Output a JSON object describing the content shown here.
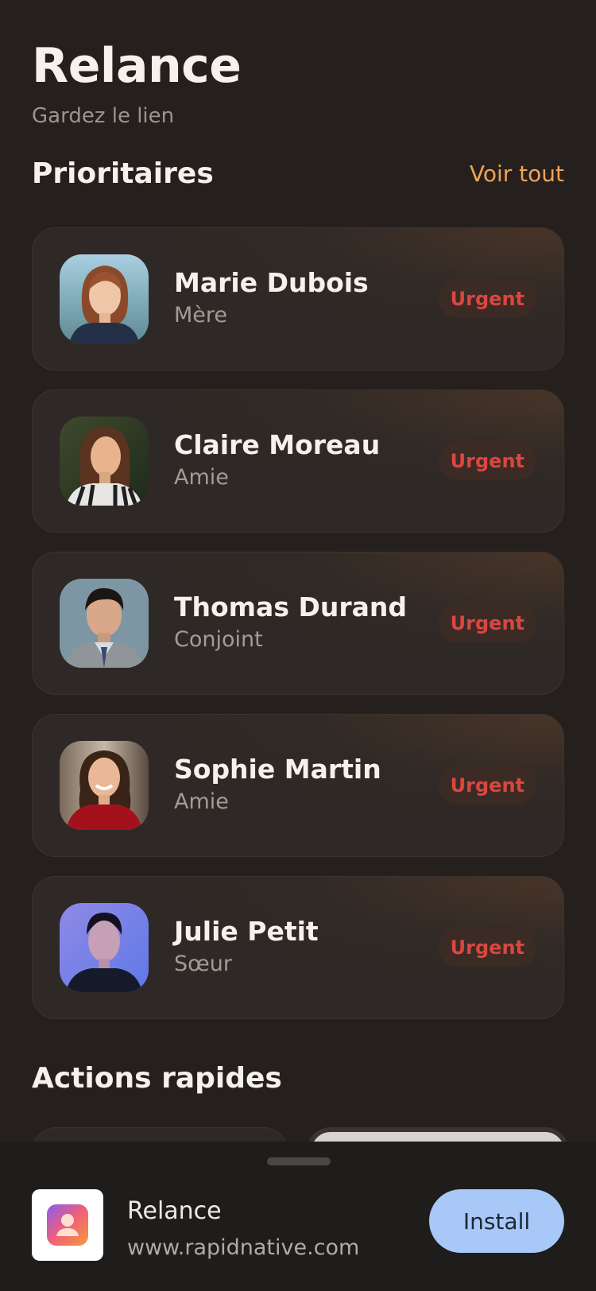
{
  "header": {
    "title": "Relance",
    "subtitle": "Gardez le lien"
  },
  "priority": {
    "section_title": "Prioritaires",
    "see_all_label": "Voir tout",
    "contacts": [
      {
        "name": "Marie Dubois",
        "relation": "Mère",
        "badge": "Urgent"
      },
      {
        "name": "Claire Moreau",
        "relation": "Amie",
        "badge": "Urgent"
      },
      {
        "name": "Thomas Durand",
        "relation": "Conjoint",
        "badge": "Urgent"
      },
      {
        "name": "Sophie Martin",
        "relation": "Amie",
        "badge": "Urgent"
      },
      {
        "name": "Julie Petit",
        "relation": "Sœur",
        "badge": "Urgent"
      }
    ]
  },
  "quick_actions": {
    "section_title": "Actions rapides"
  },
  "install_banner": {
    "app_name": "Relance",
    "url": "www.rapidnative.com",
    "install_label": "Install"
  },
  "colors": {
    "background": "#25201e",
    "accent": "#f0a257",
    "urgent": "#d9473f",
    "install_button": "#a8c8f8"
  }
}
